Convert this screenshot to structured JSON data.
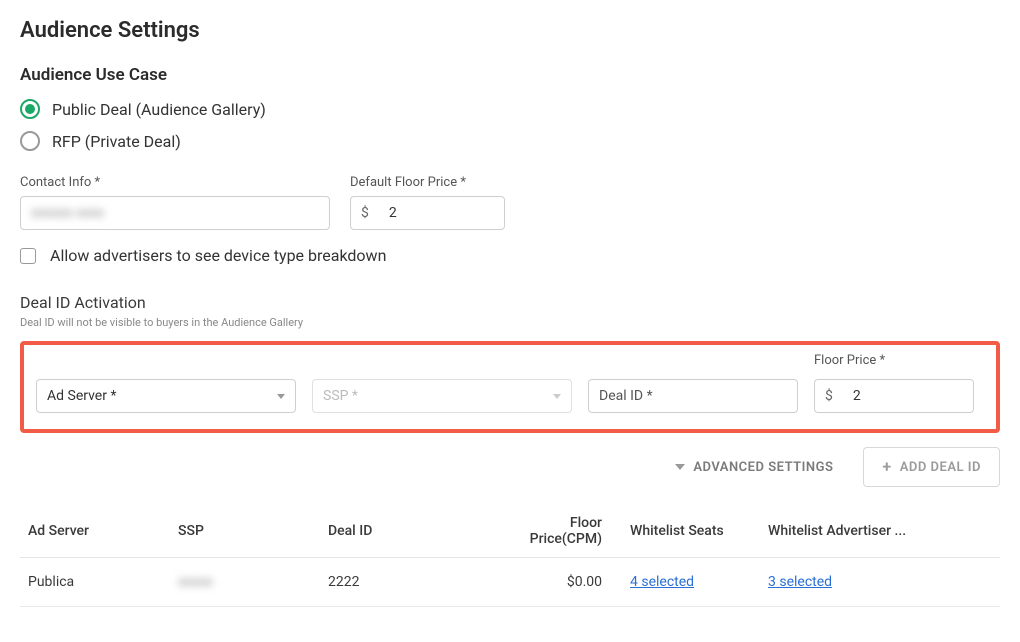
{
  "page_title": "Audience Settings",
  "use_case": {
    "heading": "Audience Use Case",
    "options": [
      {
        "label": "Public Deal (Audience Gallery)",
        "selected": true
      },
      {
        "label": "RFP (Private Deal)",
        "selected": false
      }
    ]
  },
  "contact": {
    "label": "Contact Info *",
    "value": "xxxxxx xxxx"
  },
  "default_floor": {
    "label": "Default Floor Price *",
    "currency": "$",
    "value": "2"
  },
  "allow_device_breakdown": {
    "label": "Allow advertisers to see device type breakdown",
    "checked": false
  },
  "deal_id_activation": {
    "heading": "Deal ID Activation",
    "helper": "Deal ID will not be visible to buyers in the Audience Gallery"
  },
  "new_deal_row": {
    "ad_server": {
      "label": "Ad Server *",
      "value": ""
    },
    "ssp": {
      "label": "SSP *",
      "value": "",
      "disabled": true
    },
    "deal_id": {
      "label": "Deal ID *",
      "value": ""
    },
    "floor_price": {
      "label": "Floor Price *",
      "currency": "$",
      "value": "2"
    }
  },
  "actions": {
    "advanced_settings": "ADVANCED SETTINGS",
    "add_deal_id": "ADD DEAL ID"
  },
  "table": {
    "headers": {
      "ad_server": "Ad Server",
      "ssp": "SSP",
      "deal_id": "Deal ID",
      "floor_price": "Floor Price(CPM)",
      "whitelist_seats": "Whitelist Seats",
      "whitelist_adv": "Whitelist Advertiser ..."
    },
    "rows": [
      {
        "ad_server": "Publica",
        "ssp": "xxxxx",
        "deal_id": "2222",
        "floor_price": "$0.00",
        "whitelist_seats": "4 selected",
        "whitelist_adv": "3 selected"
      }
    ]
  }
}
